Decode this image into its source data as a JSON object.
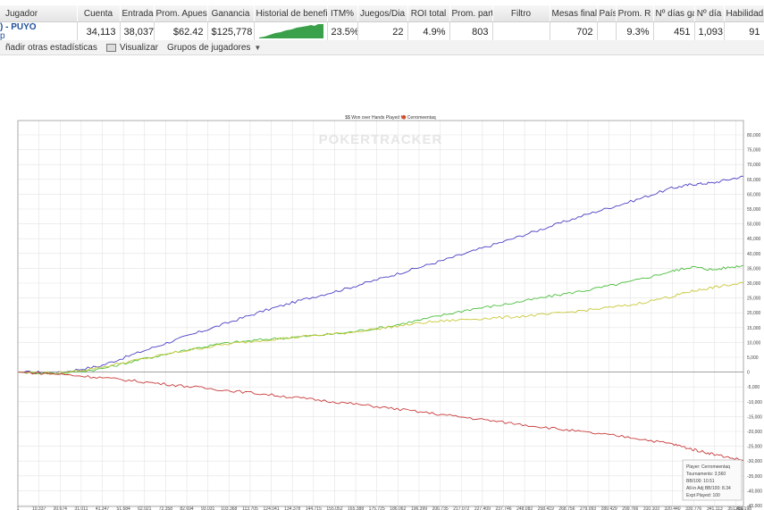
{
  "table": {
    "headers": [
      "Jugador",
      "Cuenta",
      "Entradas",
      "Prom. Apuest",
      "Ganancia",
      "Historial de benefi",
      "ITM%",
      "Juegos/Dia",
      "ROI total",
      "Prom. part",
      "Filtro",
      "Mesas finale",
      "País",
      "Prom. R",
      "Nº días ga",
      "Nº día",
      "Habilidad"
    ],
    "row": {
      "player_name": ") - PUYÓ",
      "player_sub": "p",
      "cells": [
        "34,113",
        "38,037",
        "$62.42",
        "$125,778",
        "",
        "23.5%",
        "22",
        "4.9%",
        "803",
        "",
        "702",
        "",
        "9.3%",
        "451",
        "1,093",
        "91"
      ]
    },
    "sparkline_color": "#3aa04a"
  },
  "toolbar": {
    "add_stats": "ñadir otras estadísticas",
    "visualize": "Visualizar",
    "groups": "Grupos de jugadores"
  },
  "chart_data": {
    "type": "line",
    "title": "$$ Won over Hands Played for  Cerromeentaq",
    "watermark": "POKERTRACKER",
    "x_ticks": [
      "1",
      "10,337",
      "20,674",
      "31,011",
      "41,347",
      "51,684",
      "62,021",
      "72,358",
      "82,694",
      "93,031",
      "103,368",
      "113,705",
      "124,041",
      "134,378",
      "144,715",
      "155,052",
      "165,388",
      "175,725",
      "186,062",
      "196,399",
      "206,735",
      "217,072",
      "227,409",
      "237,746",
      "248,082",
      "258,419",
      "268,756",
      "279,093",
      "289,429",
      "299,766",
      "310,103",
      "320,440",
      "330,776",
      "341,113",
      "351,450",
      "355,198"
    ],
    "y_ticks": [
      "80,000",
      "75,000",
      "70,000",
      "65,000",
      "60,000",
      "55,000",
      "50,000",
      "45,000",
      "40,000",
      "35,000",
      "30,000",
      "25,000",
      "20,000",
      "15,000",
      "10,000",
      "5,000",
      "0",
      "-5,000",
      "-10,000",
      "-15,000",
      "-20,000",
      "-25,000",
      "-30,000",
      "-35,000",
      "-40,000",
      "-45,000"
    ],
    "ylim": [
      -45000,
      80000
    ],
    "xlim": [
      1,
      355198
    ],
    "grid": true,
    "legend_position": "bottom-right",
    "series": [
      {
        "color": "#4a3fc4",
        "x": [
          1,
          20000,
          40000,
          60000,
          80000,
          100000,
          120000,
          140000,
          160000,
          180000,
          200000,
          220000,
          240000,
          260000,
          280000,
          300000,
          320000,
          330000,
          340000,
          355198
        ],
        "values": [
          0,
          -200,
          2000,
          6800,
          11500,
          16000,
          20600,
          24500,
          28000,
          32000,
          36000,
          40200,
          44500,
          49000,
          53500,
          57500,
          62000,
          63300,
          63800,
          66000
        ]
      },
      {
        "color": "#4cbf3e",
        "x": [
          1,
          20000,
          40000,
          60000,
          80000,
          100000,
          120000,
          140000,
          160000,
          180000,
          200000,
          220000,
          240000,
          260000,
          280000,
          300000,
          320000,
          330000,
          340000,
          355198
        ],
        "values": [
          0,
          -500,
          1000,
          4200,
          7200,
          9600,
          11000,
          12000,
          13200,
          15200,
          18000,
          21000,
          23000,
          25500,
          27800,
          30500,
          34000,
          35500,
          34500,
          36000
        ]
      },
      {
        "color": "#c8c83a",
        "x": [
          1,
          20000,
          40000,
          60000,
          80000,
          100000,
          120000,
          140000,
          160000,
          180000,
          200000,
          220000,
          240000,
          260000,
          280000,
          300000,
          320000,
          330000,
          340000,
          355198
        ],
        "values": [
          0,
          -400,
          1500,
          4300,
          7000,
          9200,
          10800,
          12000,
          13200,
          15000,
          16800,
          17800,
          18500,
          19500,
          21000,
          22600,
          25500,
          27300,
          28500,
          30000
        ]
      },
      {
        "color": "#c83a3a",
        "x": [
          1,
          20000,
          40000,
          60000,
          80000,
          100000,
          120000,
          140000,
          160000,
          180000,
          200000,
          220000,
          240000,
          260000,
          280000,
          300000,
          320000,
          330000,
          340000,
          355198
        ],
        "values": [
          0,
          -700,
          -1800,
          -3200,
          -4600,
          -6000,
          -7400,
          -8900,
          -10400,
          -12000,
          -13700,
          -15400,
          -17100,
          -18800,
          -20500,
          -22000,
          -24200,
          -26000,
          -27600,
          -29800
        ]
      }
    ],
    "legend_lines": [
      "Player: Cerromeentaq",
      "Tournaments: 3,560",
      "BB/100: 10.51",
      "All-in Adj BB/100: 8.34",
      "Expt Played: 100"
    ]
  }
}
